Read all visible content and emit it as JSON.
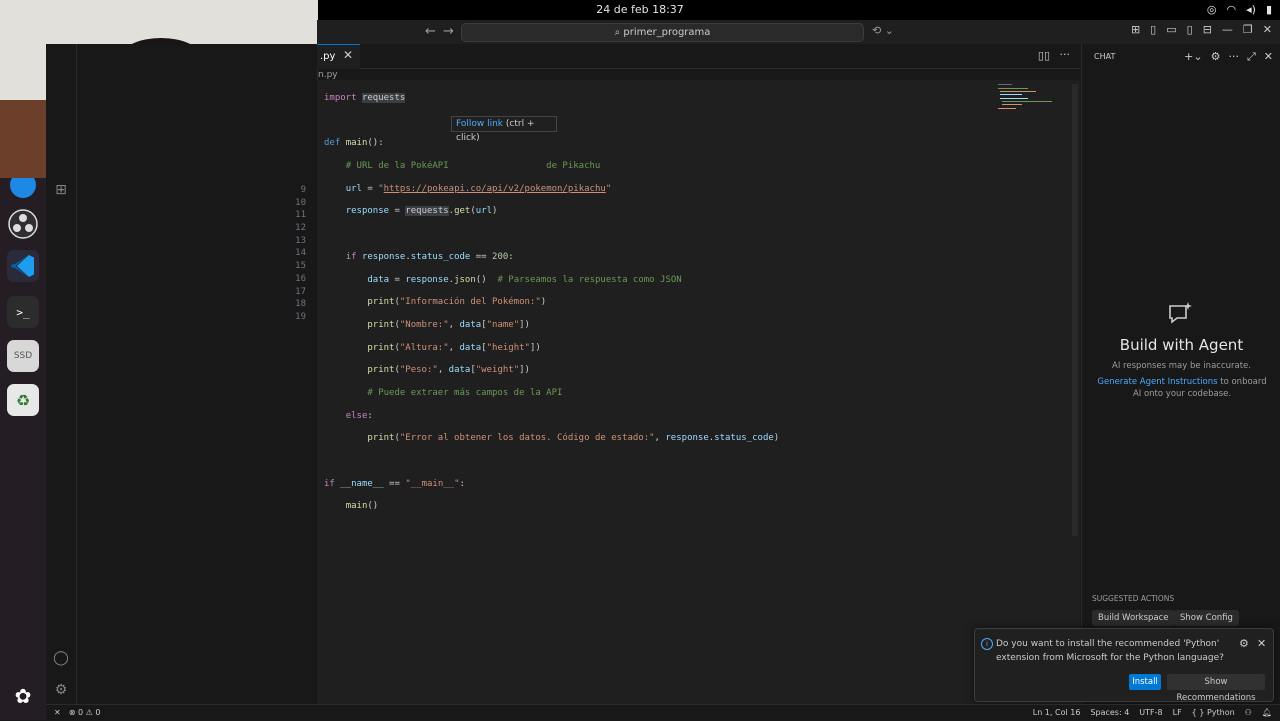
{
  "system": {
    "clock": "24 de feb  18:37"
  },
  "window": {
    "command_center": "primer_programa",
    "tab_label": ".py",
    "breadcrumb": "n.py"
  },
  "editor": {
    "gutter": [
      "9",
      "10",
      "11",
      "12",
      "13",
      "14",
      "15",
      "16",
      "17",
      "18",
      "19"
    ],
    "hover_text": "Follow link",
    "hover_hint": "(ctrl + click)"
  },
  "chat": {
    "title": "CHAT",
    "agent_title": "Build with Agent",
    "agent_sub": "AI responses may be inaccurate.",
    "agent_link": "Generate Agent Instructions",
    "agent_desc_rest": " to onboard AI onto your codebase.",
    "suggested_label": "SUGGESTED ACTIONS",
    "btn_build": "Build Workspace",
    "btn_config": "Show Config"
  },
  "notification": {
    "message": "Do you want to install the recommended 'Python' extension from Microsoft for the Python language?",
    "install": "Install",
    "recommendations": "Show Recommendations"
  },
  "status": {
    "errors": "0",
    "warnings": "0",
    "position": "Ln 1, Col 16",
    "spaces": "Spaces: 4",
    "encoding": "UTF-8",
    "eol": "LF",
    "language": "Python"
  },
  "colors": {
    "accent": "#0078d4",
    "link": "#4daafc",
    "editor_bg": "#1f1f1f",
    "dock_bg": "#241d24"
  }
}
